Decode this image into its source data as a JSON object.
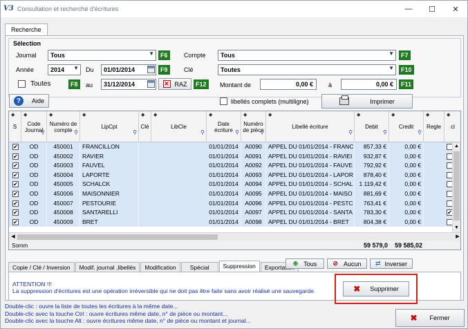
{
  "window": {
    "logo": "V3",
    "title": "Consultation et recherche d'écritures",
    "minimize": "—",
    "maximize": "☐",
    "close": "✕"
  },
  "tab_main": "Recherche",
  "selection": {
    "title": "Sélection",
    "journal_label": "Journal",
    "journal_value": "Tous",
    "compte_label": "Compte",
    "compte_value": "Tous",
    "annee_label": "Année",
    "annee_value": "2014",
    "du_label": "Du",
    "du_value": "01/01/2014",
    "au_label": "au",
    "au_value": "31/12/2014",
    "cle_label": "Clé",
    "cle_value": "Toutes",
    "toutes_label": "Toutes",
    "raz_label": "RAZ",
    "montant_label": "Montant de",
    "montant_from": "0,00 €",
    "a_label": "à",
    "montant_to": "0,00 €",
    "keys": {
      "f6": "F6",
      "f7": "F7",
      "f8": "F8",
      "f9": "F9",
      "f10": "F10",
      "f11": "F11",
      "f12": "F12"
    }
  },
  "toolbar": {
    "aide_label": "Aide",
    "libelles_label": "libellés complets (multiligne)",
    "imprimer_label": "Imprimer"
  },
  "grid": {
    "headers": {
      "s": "S",
      "code_journal": "Code Journal",
      "numero_compte": "Numéro de compte",
      "lipcpt": "LipCpt",
      "cle": "Clé",
      "libcle": "LibCle",
      "date_ecriture": "Date écriture",
      "numero_piece": "Numéro de pièce",
      "libelle": "Libellé écriture",
      "debit": "Debit",
      "credit": "Credit",
      "regle": "Regle",
      "cl": "cl"
    },
    "rows": [
      {
        "journal": "OD",
        "compte": "450001",
        "nom": "FRANCILLON",
        "date": "01/01/2014",
        "piece": "A0090",
        "libelle": "APPEL DU 01/01/2014 - FRANC",
        "debit": "857,33 €",
        "credit": "0,00 €",
        "checked": "✔",
        "regle": ""
      },
      {
        "journal": "OD",
        "compte": "450002",
        "nom": "RAVIER",
        "date": "01/01/2014",
        "piece": "A0091",
        "libelle": "APPEL DU 01/01/2014 - RAVIEI",
        "debit": "932,87 €",
        "credit": "0,00 €",
        "checked": "✔",
        "regle": ""
      },
      {
        "journal": "OD",
        "compte": "450003",
        "nom": "FAUVEL",
        "date": "01/01/2014",
        "piece": "A0092",
        "libelle": "APPEL DU 01/01/2014 - FAUVE",
        "debit": "792,92 €",
        "credit": "0,00 €",
        "checked": "✔",
        "regle": ""
      },
      {
        "journal": "OD",
        "compte": "450004",
        "nom": "LAPORTE",
        "date": "01/01/2014",
        "piece": "A0093",
        "libelle": "APPEL DU 01/01/2014 - LAPOR",
        "debit": "878,40 €",
        "credit": "0,00 €",
        "checked": "✔",
        "regle": ""
      },
      {
        "journal": "OD",
        "compte": "450005",
        "nom": "SCHALCK",
        "date": "01/01/2014",
        "piece": "A0094",
        "libelle": "APPEL DU 01/01/2014 - SCHAL",
        "debit": "1 119,42 €",
        "credit": "0,00 €",
        "checked": "✔",
        "regle": ""
      },
      {
        "journal": "OD",
        "compte": "450006",
        "nom": "MAISONNIER",
        "date": "01/01/2014",
        "piece": "A0095",
        "libelle": "APPEL DU 01/01/2014 - MAISO",
        "debit": "881,69 €",
        "credit": "0,00 €",
        "checked": "✔",
        "regle": ""
      },
      {
        "journal": "OD",
        "compte": "450007",
        "nom": "PESTOURIE",
        "date": "01/01/2014",
        "piece": "A0096",
        "libelle": "APPEL DU 01/01/2014 - PESTC",
        "debit": "763,41 €",
        "credit": "0,00 €",
        "checked": "✔",
        "regle": ""
      },
      {
        "journal": "OD",
        "compte": "450008",
        "nom": "SANTARELLI",
        "date": "01/01/2014",
        "piece": "A0097",
        "libelle": "APPEL DU 01/01/2014 - SANTA",
        "debit": "783,30 €",
        "credit": "0,00 €",
        "checked": "✔",
        "regle": "✔"
      },
      {
        "journal": "OD",
        "compte": "450009",
        "nom": "BRET",
        "date": "01/01/2014",
        "piece": "A0098",
        "libelle": "APPEL DU 01/01/2014 - BRET",
        "debit": "804,38 €",
        "credit": "0,00 €",
        "checked": "✔",
        "regle": ""
      }
    ],
    "sum_label": "Somm",
    "sum_debit": "59 579,0",
    "sum_credit": "59 585,02"
  },
  "bottom_tabs": [
    "Copie / Clé / Inversion",
    "Modif. journal ,libellés",
    "Modification",
    "Spécial",
    "Suppression",
    "Exportation"
  ],
  "bottom_actions": {
    "tous_label": "Tous",
    "aucun_label": "Aucun",
    "inverser_label": "Inverser"
  },
  "panel": {
    "attention_title": "ATTENTION !!!",
    "attention_text": "La suppression d'écritures est une opération irréversible qui ne doit pas être faite sans avoir réalisé une sauvegarde.",
    "supprimer_label": "Supprimer"
  },
  "status_lines": [
    "Double-clic : ouvre la liste de toutes les écritures à la même date...",
    "Double-clic avec la touche Ctrl : ouvre écritures même date, n° de pièce ou montant...",
    "Double-clic avec la touche Alt : ouvre écritures même date, n° de pièce ou montant et journal..."
  ],
  "fermer_label": "Fermer"
}
